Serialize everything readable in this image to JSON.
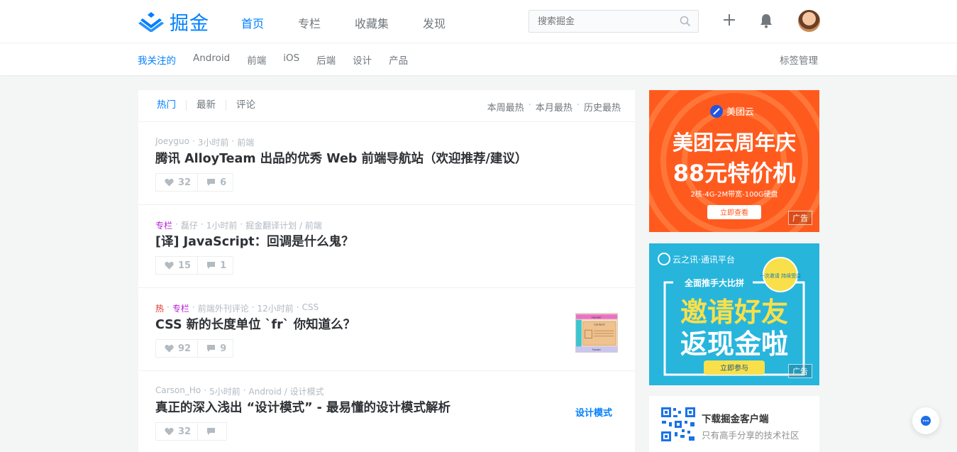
{
  "header": {
    "logo_text": "掘金",
    "nav": [
      "首页",
      "专栏",
      "收藏集",
      "发现"
    ],
    "active_nav": "首页",
    "search": {
      "placeholder": "搜索掘金"
    }
  },
  "subnav": {
    "items": [
      "我关注的",
      "Android",
      "前端",
      "iOS",
      "后端",
      "设计",
      "产品"
    ],
    "active": "我关注的",
    "tag_manage": "标签管理"
  },
  "feed": {
    "tabs": [
      "热门",
      "最新",
      "评论"
    ],
    "active_tab": "热门",
    "ranges": [
      "本周最热",
      "本月最热",
      "历史最热"
    ],
    "entries": [
      {
        "meta": [
          "Joeyguo",
          "3小时前",
          "前端"
        ],
        "title": "腾讯 AlloyTeam 出品的优秀 Web 前端导航站（欢迎推荐/建议）",
        "likes": "32",
        "comments": "6"
      },
      {
        "badge_zl": "专栏",
        "meta": [
          "磊仔",
          "1小时前",
          "掘金翻译计划 / 前端"
        ],
        "title": "[译] JavaScript：回调是什么鬼？",
        "likes": "15",
        "comments": "1"
      },
      {
        "badge_hot": "热",
        "badge_zl": "专栏",
        "meta": [
          "前端外刊评论",
          "12小时前",
          "CSS"
        ],
        "title": "CSS 新的长度单位 `fr` 你知道么？",
        "likes": "92",
        "comments": "9",
        "thumb_labels": [
          "Header",
          "Content",
          "Footer"
        ]
      },
      {
        "meta": [
          "Carson_Ho",
          "5小时前",
          "Android / 设计模式"
        ],
        "title": "真正的深入浅出 “设计模式” - 最易懂的设计模式解析",
        "likes": "32",
        "comments": "",
        "tag": "设计模式"
      }
    ]
  },
  "ads": [
    {
      "brand": "美团云",
      "headline": "美团云周年庆",
      "headline2": "88元特价机",
      "spec": "2核-4G-2M带宽-100G硬盘",
      "cta": "立即查看",
      "tag": "广告",
      "bg_color": "#ff5a1e"
    },
    {
      "brand": "云之讯·通讯平台",
      "sub": "全面推手大比拼",
      "badge": "一次邀请 持续受益",
      "headline": "邀请好友",
      "headline2": "返现金啦",
      "cta": "立即参与",
      "tag": "广告",
      "bg_color": "#27b5dc"
    }
  ],
  "app_download": {
    "title": "下载掘金客户端",
    "subtitle": "只有高手分享的技术社区"
  },
  "colors": {
    "accent": "#007fff",
    "hot": "#e4312d",
    "column": "#b71ed7"
  }
}
